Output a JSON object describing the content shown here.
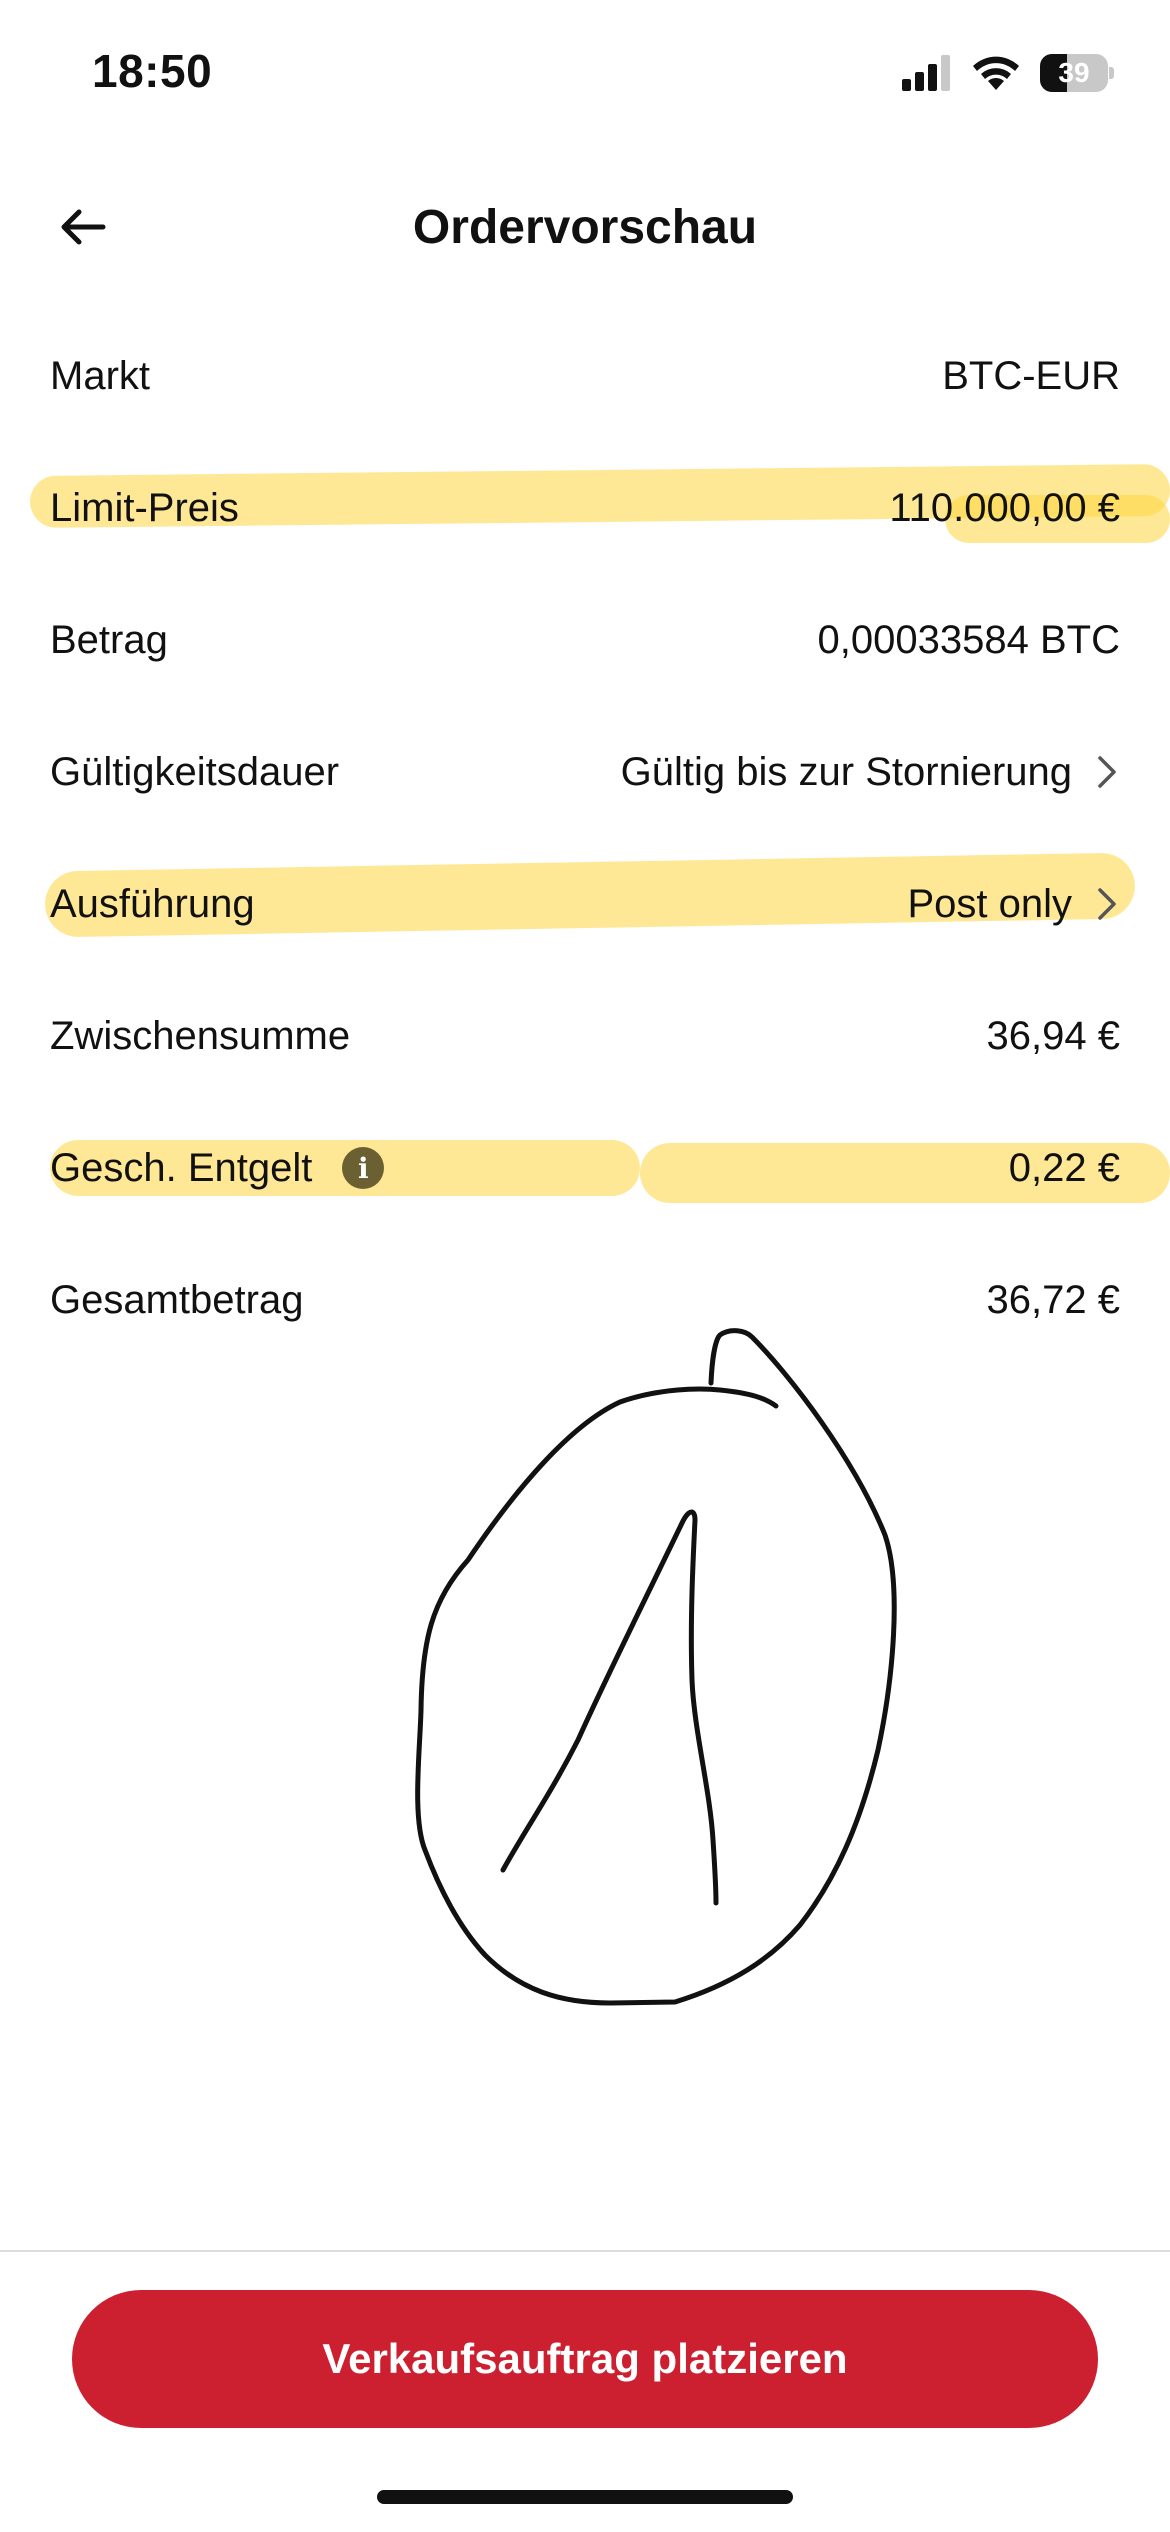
{
  "status_bar": {
    "time": "18:50",
    "battery": "39",
    "battery_level": 0.39,
    "icons": [
      "signal-icon",
      "wifi-icon",
      "battery-icon"
    ]
  },
  "header": {
    "title": "Ordervorschau",
    "back_icon": "arrow-left-icon"
  },
  "rows": [
    {
      "label": "Markt",
      "value": "BTC-EUR"
    },
    {
      "label": "Limit-Preis",
      "value": "110.000,00 €"
    },
    {
      "label": "Betrag",
      "value": "0,00033584 BTC"
    },
    {
      "label": "Gültigkeitsdauer",
      "value": "Gültig bis zur Stornierung",
      "icon": "chevron-right-icon"
    },
    {
      "label": "Ausführung",
      "value": "Post only",
      "icon": "chevron-right-icon"
    },
    {
      "label": "Zwischensumme",
      "value": "36,94 €"
    },
    {
      "label": "Gesch. Entgelt",
      "value": "0,22 €",
      "label_icon": "info-icon"
    },
    {
      "label": "Gesamtbetrag",
      "value": "36,72 €"
    }
  ],
  "annotations": {
    "highlight_color": "#ffd63e",
    "highlighted_rows": [
      "Limit-Preis",
      "Ausführung",
      "Gesch. Entgelt"
    ],
    "drawing": "hand-drawn-sketch"
  },
  "cta": {
    "label": "Verkaufsauftrag platzieren",
    "color": "#cc1f2f"
  }
}
